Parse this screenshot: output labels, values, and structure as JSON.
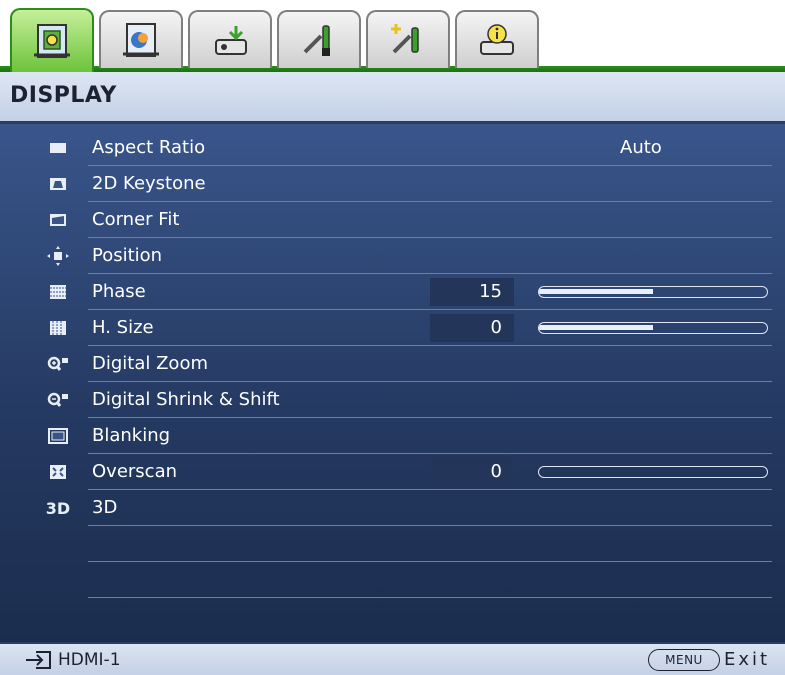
{
  "tabs": [
    {
      "icon": "display-tab-icon",
      "active": true
    },
    {
      "icon": "picture-tab-icon",
      "active": false
    },
    {
      "icon": "source-tab-icon",
      "active": false
    },
    {
      "icon": "system-setup-basic-tab-icon",
      "active": false
    },
    {
      "icon": "system-setup-advanced-tab-icon",
      "active": false
    },
    {
      "icon": "information-tab-icon",
      "active": false
    }
  ],
  "header": {
    "title": "DISPLAY"
  },
  "menu": {
    "items": [
      {
        "label": "Aspect Ratio",
        "icon": "aspect-ratio-icon",
        "value": "Auto"
      },
      {
        "label": "2D Keystone",
        "icon": "keystone-icon"
      },
      {
        "label": "Corner Fit",
        "icon": "corner-fit-icon"
      },
      {
        "label": "Position",
        "icon": "position-icon"
      },
      {
        "label": "Phase",
        "icon": "phase-icon",
        "number": "15",
        "level": 0.5
      },
      {
        "label": "H. Size",
        "icon": "h-size-icon",
        "number": "0",
        "level": 0.5
      },
      {
        "label": "Digital Zoom",
        "icon": "digital-zoom-icon"
      },
      {
        "label": "Digital Shrink & Shift",
        "icon": "digital-shrink-icon"
      },
      {
        "label": "Blanking",
        "icon": "blanking-icon"
      },
      {
        "label": "Overscan",
        "icon": "overscan-icon",
        "number": "0",
        "level": 0.0
      },
      {
        "label": "3D",
        "icon": "3d-icon",
        "icon_text": "3D"
      }
    ]
  },
  "footer": {
    "source": "HDMI-1",
    "menu_key": "MENU",
    "exit": "Exit"
  },
  "colors": {
    "active_tab": "#6cc33b",
    "panel": "#2d4574",
    "header": "#cfdaee"
  }
}
